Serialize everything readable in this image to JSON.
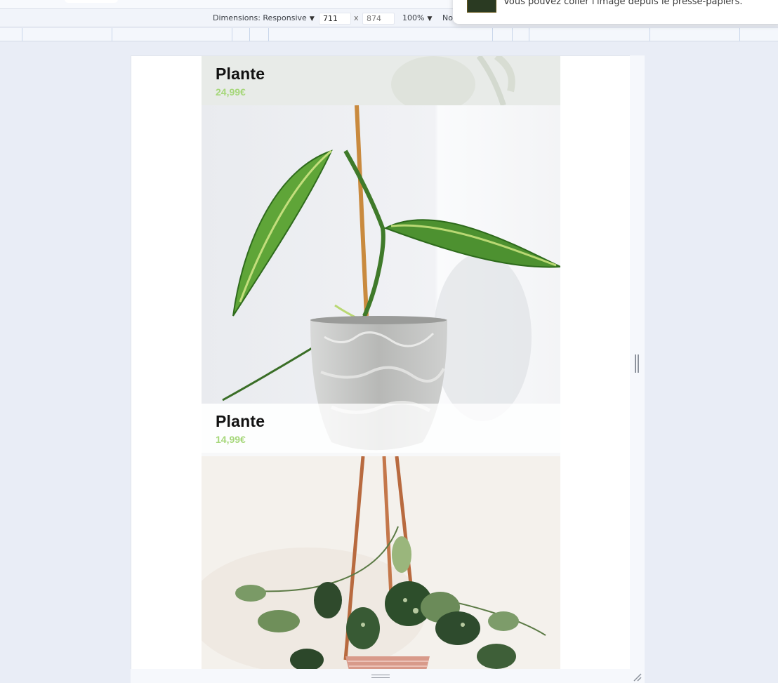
{
  "devtools": {
    "dimensions_label": "Dimensions: Responsive",
    "width_value": "711",
    "height_placeholder": "874",
    "times_sign": "x",
    "zoom_label": "100%",
    "throttle_label": "No",
    "colors": {
      "toolbar_bg": "#f1f4fa",
      "page_bg": "#e9edf6"
    }
  },
  "notification": {
    "message": "Vous pouvez coller l'image depuis le presse-papiers."
  },
  "products": [
    {
      "name": "Plante",
      "price": "24,99€"
    },
    {
      "name": "Plante",
      "price": "14,99€"
    }
  ],
  "theme": {
    "price_color": "#a6d77a"
  }
}
